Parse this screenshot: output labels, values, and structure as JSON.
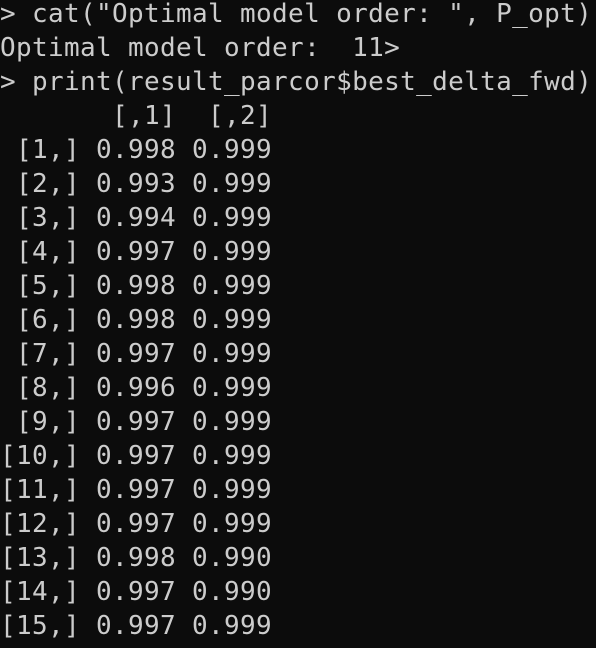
{
  "console": {
    "lines": [
      "> cat(\"Optimal model order: \", P_opt)",
      "Optimal model order:  11>",
      "> print(result_parcor$best_delta_fwd)",
      "       [,1]  [,2]",
      " [1,] 0.998 0.999",
      " [2,] 0.993 0.999",
      " [3,] 0.994 0.999",
      " [4,] 0.997 0.999",
      " [5,] 0.998 0.999",
      " [6,] 0.998 0.999",
      " [7,] 0.997 0.999",
      " [8,] 0.996 0.999",
      " [9,] 0.997 0.999",
      "[10,] 0.997 0.999",
      "[11,] 0.997 0.999",
      "[12,] 0.997 0.999",
      "[13,] 0.998 0.990",
      "[14,] 0.997 0.990",
      "[15,] 0.997 0.999"
    ]
  },
  "colors": {
    "background": "#0c0c0c",
    "text": "#cccccc"
  }
}
